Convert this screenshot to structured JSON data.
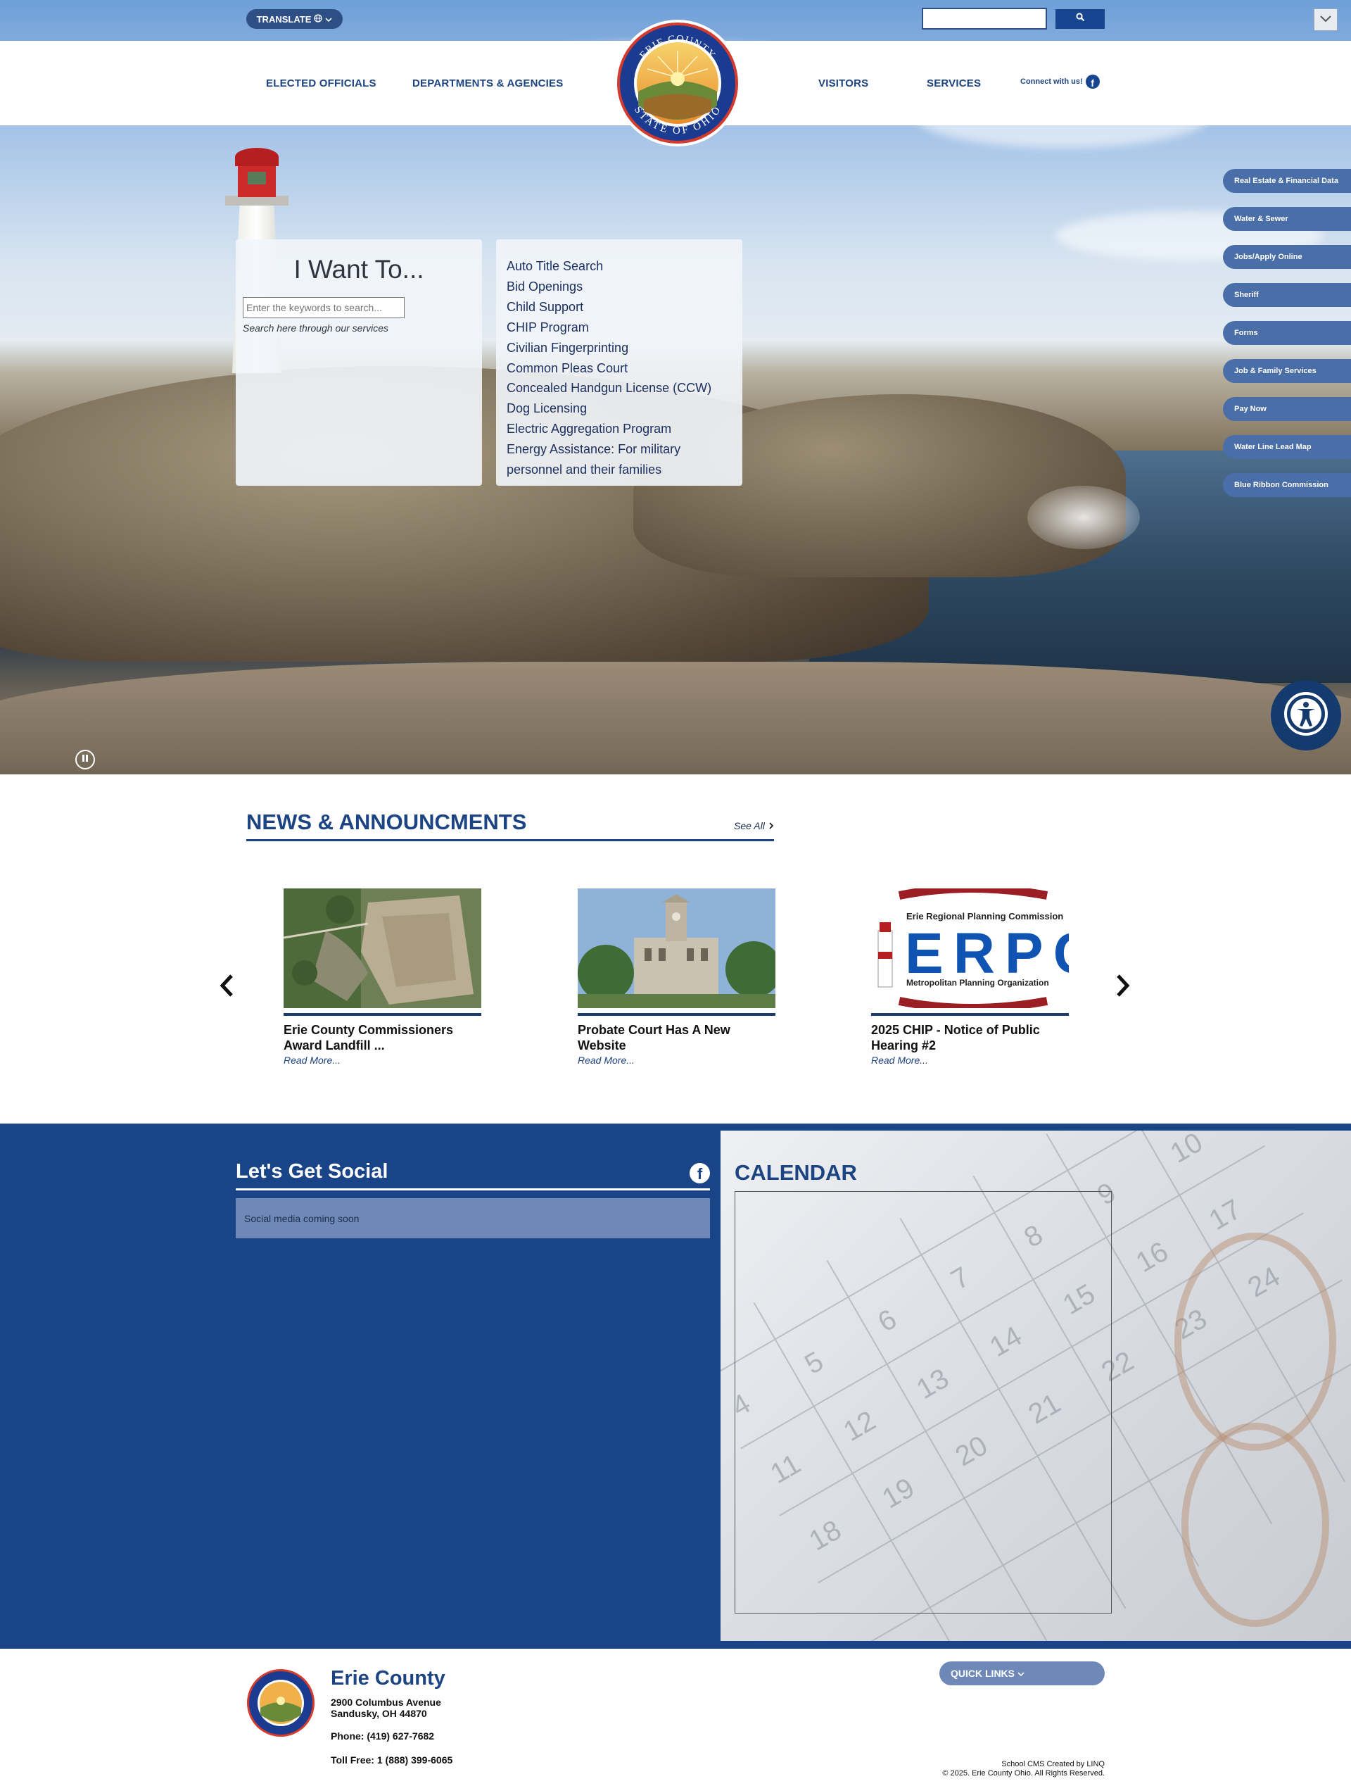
{
  "header": {
    "translate_label": "TRANSLATE",
    "search_placeholder": "",
    "nav": [
      "ELECTED OFFICIALS",
      "DEPARTMENTS & AGENCIES",
      "VISITORS",
      "SERVICES"
    ],
    "connect_label": "Connect with us!",
    "seal_top_text": "ERIE COUNTY",
    "seal_bottom_text": "STATE OF OHIO"
  },
  "iwant": {
    "title": "I Want To...",
    "input_placeholder": "Enter the keywords to search...",
    "hint": "Search here through our services"
  },
  "services": [
    "Auto Title Search",
    "Bid Openings",
    "Child Support",
    "CHIP Program",
    "Civilian Fingerprinting",
    "Common Pleas Court",
    "Concealed Handgun License (CCW)",
    "Dog Licensing",
    "Electric Aggregation Program",
    "Energy Assistance: For military",
    "personnel and their families"
  ],
  "side_tabs": [
    "Real Estate & Financial Data",
    "Water & Sewer",
    "Jobs/Apply Online",
    "Sheriff",
    "Forms",
    "Job & Family Services",
    "Pay Now",
    "Water Line Lead Map",
    "Blue Ribbon Commission"
  ],
  "news": {
    "title": "NEWS & ANNOUNCMENTS",
    "see_all": "See All",
    "cards": [
      {
        "title": "Erie County Commissioners Award Landfill ...",
        "more": "Read More..."
      },
      {
        "title": "Probate Court Has A New Website",
        "more": "Read More..."
      },
      {
        "title": "2025 CHIP - Notice of Public Hearing #2",
        "more": "Read More..."
      }
    ],
    "erpc": {
      "line1": "Erie Regional Planning Commission",
      "letters": "ERPC",
      "line2": "Metropolitan Planning Organization"
    }
  },
  "social": {
    "title": "Let's Get Social",
    "message": "Social media coming soon"
  },
  "calendar": {
    "title": "CALENDAR"
  },
  "footer": {
    "name": "Erie County",
    "address1": "2900 Columbus Avenue",
    "address2": "Sandusky, OH 44870",
    "phone": "Phone: (419) 627-7682",
    "tollfree": "Toll Free: 1 (888) 399-6065",
    "quick_links": "QUICK LINKS",
    "credit": "School CMS Created by LINQ",
    "copyright": "© 2025. Erie County Ohio. All Rights Reserved."
  },
  "colors": {
    "brand_blue": "#1c4382",
    "band_blue": "#1a4488",
    "tab_blue": "#4a6ea8"
  }
}
